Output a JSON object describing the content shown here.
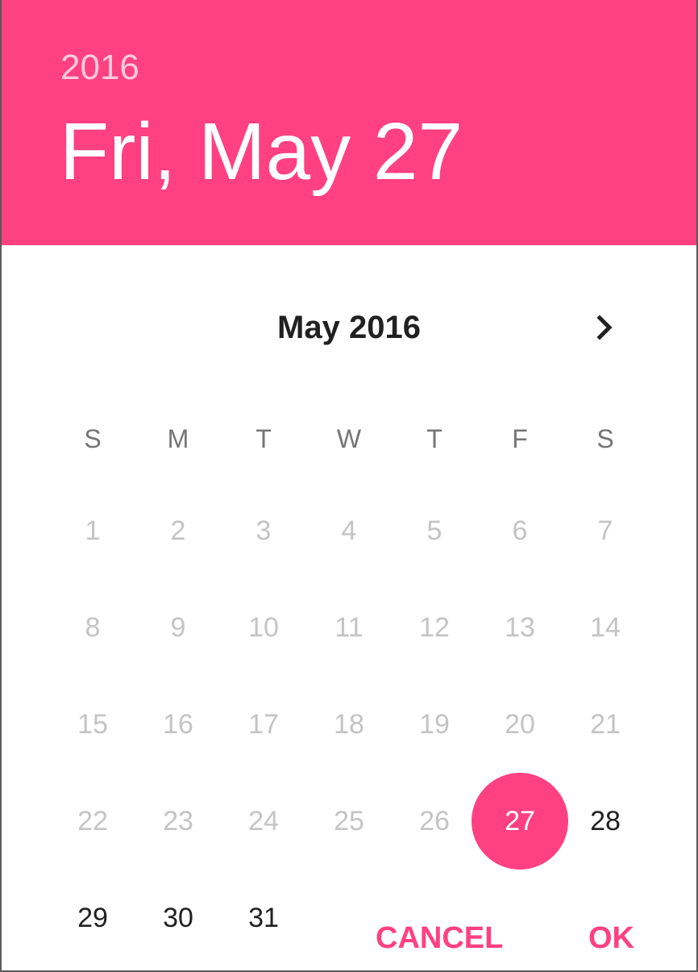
{
  "header": {
    "year": "2016",
    "date": "Fri, May 27"
  },
  "calendar": {
    "month_title": "May 2016",
    "next_icon": "chevron-right-icon",
    "weekdays": [
      "S",
      "M",
      "T",
      "W",
      "T",
      "F",
      "S"
    ],
    "days": [
      {
        "n": "1",
        "disabled": true
      },
      {
        "n": "2",
        "disabled": true
      },
      {
        "n": "3",
        "disabled": true
      },
      {
        "n": "4",
        "disabled": true
      },
      {
        "n": "5",
        "disabled": true
      },
      {
        "n": "6",
        "disabled": true
      },
      {
        "n": "7",
        "disabled": true
      },
      {
        "n": "8",
        "disabled": true
      },
      {
        "n": "9",
        "disabled": true
      },
      {
        "n": "10",
        "disabled": true
      },
      {
        "n": "11",
        "disabled": true
      },
      {
        "n": "12",
        "disabled": true
      },
      {
        "n": "13",
        "disabled": true
      },
      {
        "n": "14",
        "disabled": true
      },
      {
        "n": "15",
        "disabled": true
      },
      {
        "n": "16",
        "disabled": true
      },
      {
        "n": "17",
        "disabled": true
      },
      {
        "n": "18",
        "disabled": true
      },
      {
        "n": "19",
        "disabled": true
      },
      {
        "n": "20",
        "disabled": true
      },
      {
        "n": "21",
        "disabled": true
      },
      {
        "n": "22",
        "disabled": true
      },
      {
        "n": "23",
        "disabled": true
      },
      {
        "n": "24",
        "disabled": true
      },
      {
        "n": "25",
        "disabled": true
      },
      {
        "n": "26",
        "disabled": true
      },
      {
        "n": "27",
        "disabled": false,
        "selected": true
      },
      {
        "n": "28",
        "disabled": false
      },
      {
        "n": "29",
        "disabled": false
      },
      {
        "n": "30",
        "disabled": false
      },
      {
        "n": "31",
        "disabled": false
      }
    ]
  },
  "actions": {
    "cancel_label": "CANCEL",
    "ok_label": "OK"
  },
  "colors": {
    "accent": "#ff4081",
    "text_primary": "#212121",
    "text_disabled": "#c4c4c4",
    "weekday": "#757575"
  }
}
